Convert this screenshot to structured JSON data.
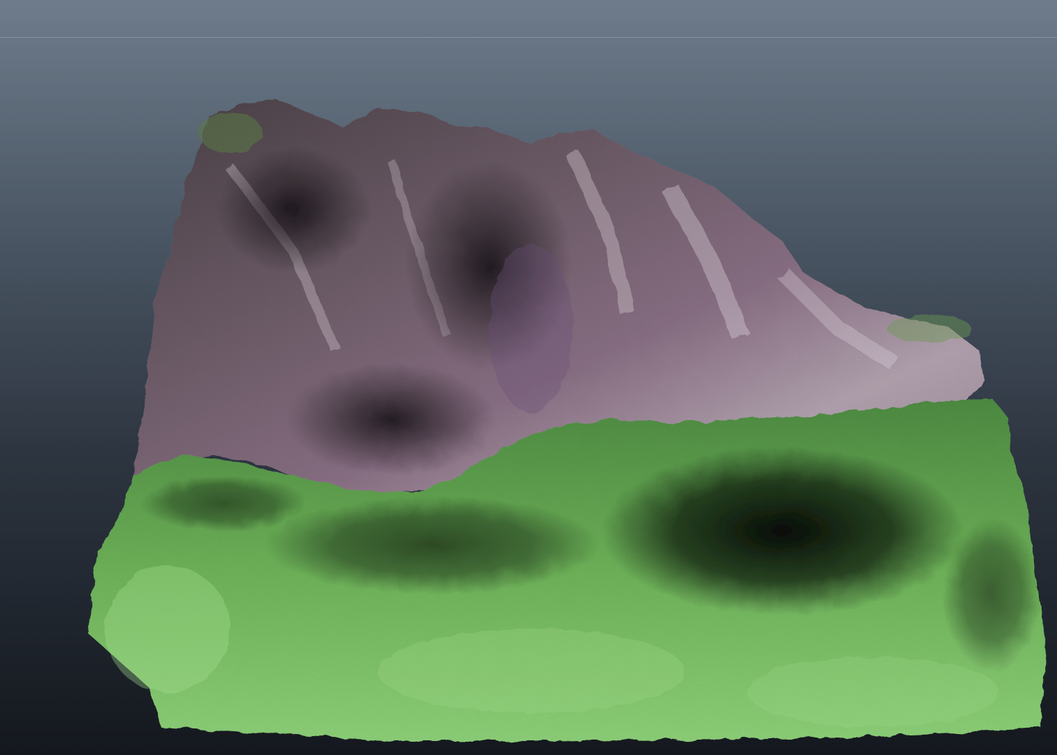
{
  "viewport": {
    "background_top": "#6e7c8b",
    "background_bottom": "#14181e",
    "horizon_color": "#aab9c8"
  },
  "terrain_model": {
    "rock_colors": [
      "#3b3438",
      "#7a6a74",
      "#c9bcc6",
      "#8d6f86",
      "#5a4a56"
    ],
    "grass_colors": [
      "#8ecf72",
      "#5ea54a",
      "#2f5a2a",
      "#0d150d"
    ],
    "sky_glow": "#aab9c8"
  }
}
